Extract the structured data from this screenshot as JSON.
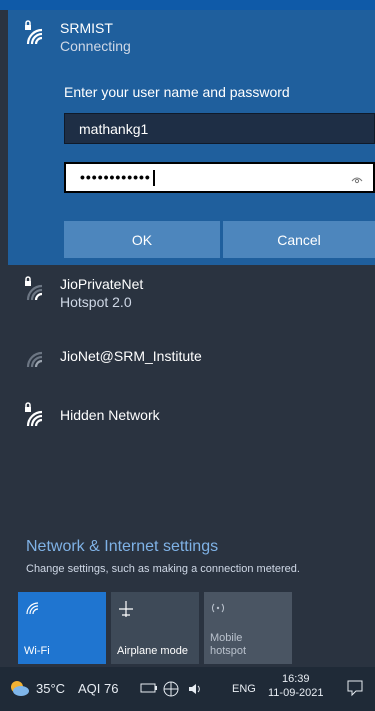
{
  "flyout": {
    "active_network": {
      "name": "SRMIST",
      "status": "Connecting",
      "prompt": "Enter your user name and password",
      "username_value": "mathankg1",
      "password_value": "••••••••••••",
      "ok_label": "OK",
      "cancel_label": "Cancel"
    },
    "networks": [
      {
        "name": "JioPrivateNet",
        "sub": "Hotspot 2.0"
      },
      {
        "name": "JioNet@SRM_Institute",
        "sub": ""
      },
      {
        "name": "Hidden Network",
        "sub": ""
      }
    ],
    "settings": {
      "title": "Network & Internet settings",
      "subtitle": "Change settings, such as making a connection metered."
    },
    "tiles": [
      {
        "label": "Wi-Fi"
      },
      {
        "label": "Airplane mode"
      },
      {
        "label": "Mobile\nhotspot"
      }
    ]
  },
  "taskbar": {
    "weather": "35°C",
    "aqi": "AQI 76",
    "lang": "ENG",
    "time": "16:39",
    "date": "11-09-2021"
  },
  "colors": {
    "flyout_bg": "#2a3340",
    "active_panel": "#1f5f9d",
    "accent": "#1f75d0",
    "taskbar_bg": "#1f2a37"
  }
}
